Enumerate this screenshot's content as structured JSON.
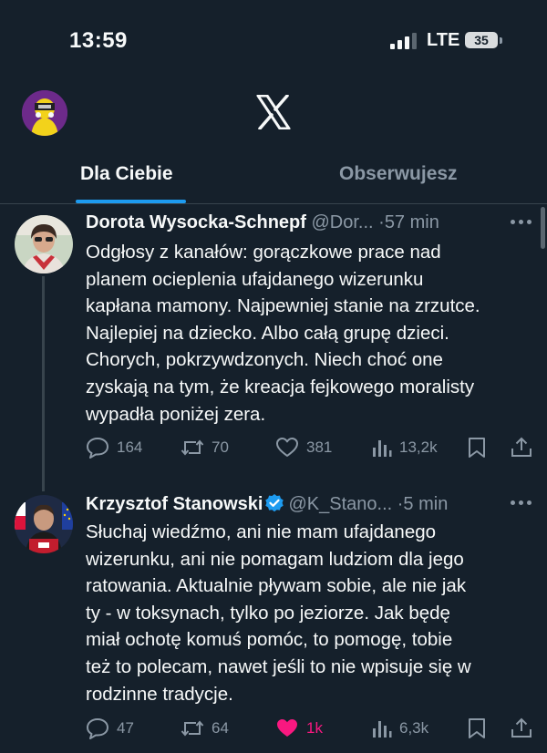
{
  "status_bar": {
    "time": "13:59",
    "network": "LTE",
    "battery": "35"
  },
  "header": {
    "logo_icon": "x-logo-icon",
    "profile_icon": "profile-avatar"
  },
  "tabs": [
    {
      "label": "Dla Ciebie",
      "active": true
    },
    {
      "label": "Obserwujesz",
      "active": false
    }
  ],
  "tweets": [
    {
      "author": "Dorota Wysocka-Schnepf",
      "handle": "@Dor...",
      "dot": "·",
      "time": "57 min",
      "verified": false,
      "lines": [
        "Odgłosy z kanałów: gorączkowe prace nad",
        "planem ocieplenia ufajdanego wizerunku",
        "kapłana mamony. Najpewniej stanie na zrzutce.",
        "Najlepiej na dziecko. Albo całą grupę dzieci.",
        "Chorych, pokrzywdzonych. Niech choć one",
        "zyskają na tym, że kreacja fejkowego moralisty",
        "wypadła poniżej zera."
      ],
      "replies": "164",
      "reposts": "70",
      "likes": "381",
      "liked": false,
      "views": "13,2k"
    },
    {
      "author": "Krzysztof Stanowski",
      "handle": "@K_Stano...",
      "dot": "·",
      "time": "5 min",
      "verified": true,
      "lines": [
        "Słuchaj wiedźmo, ani nie mam ufajdanego",
        "wizerunku, ani nie pomagam ludziom dla jego",
        "ratowania. Aktualnie pływam sobie, ale nie jak",
        "ty - w toksynach, tylko po jeziorze. Jak będę",
        "miał ochotę komuś pomóc, to pomogę, tobie",
        "też to polecam, nawet jeśli to nie wpisuje się w",
        "rodzinne tradycje."
      ],
      "replies": "47",
      "reposts": "64",
      "likes": "1k",
      "liked": true,
      "views": "6,3k"
    }
  ],
  "colors": {
    "background": "#15202b",
    "text": "#f7f9f9",
    "muted": "#8b98a5",
    "accent": "#1d9bf0",
    "like": "#f91880"
  }
}
